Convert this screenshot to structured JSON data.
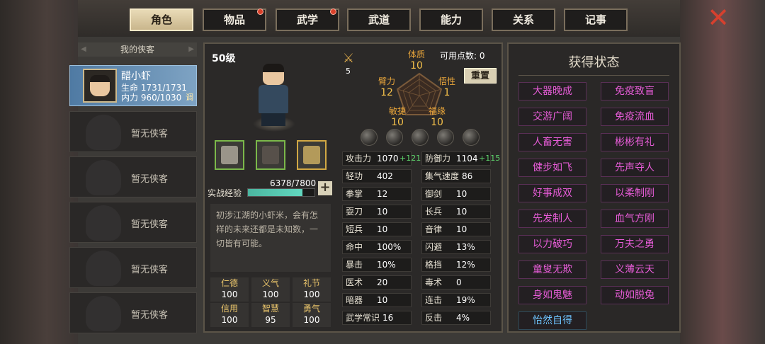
{
  "tabs": [
    {
      "label": "角色",
      "active": true,
      "dot": false
    },
    {
      "label": "物品",
      "active": false,
      "dot": true
    },
    {
      "label": "武学",
      "active": false,
      "dot": true
    },
    {
      "label": "武道",
      "active": false,
      "dot": false
    },
    {
      "label": "能力",
      "active": false,
      "dot": false
    },
    {
      "label": "关系",
      "active": false,
      "dot": false
    },
    {
      "label": "记事",
      "active": false,
      "dot": false
    }
  ],
  "close_icon": "close-icon",
  "list": {
    "header": "我的侠客",
    "hero": {
      "name": "醋小虾",
      "hp": "生命 1731/1731",
      "mp": "内力 960/1030",
      "tune": "调"
    },
    "empty_label": "暂无侠客"
  },
  "center": {
    "level": "50级",
    "exp_label": "实战经验",
    "exp_text": "6378/7800",
    "exp_fraction": 0.818,
    "exp_plus": "+",
    "description": "初涉江湖的小虾米，会有怎样的未来还都是未知数，一切皆有可能。",
    "virtues": [
      {
        "name": "仁德",
        "value": "100"
      },
      {
        "name": "义气",
        "value": "100"
      },
      {
        "name": "礼节",
        "value": "100"
      },
      {
        "name": "信用",
        "value": "100"
      },
      {
        "name": "智慧",
        "value": "95"
      },
      {
        "name": "勇气",
        "value": "100"
      }
    ],
    "attr_icon_num": "5",
    "points_label": "可用点数: 0",
    "reset": "重置",
    "attrs": {
      "tizhi": {
        "name": "体质",
        "value": "10"
      },
      "wuxing": {
        "name": "悟性",
        "value": "1"
      },
      "fuyuan": {
        "name": "福缘",
        "value": "10"
      },
      "minjie": {
        "name": "敏捷",
        "value": "10"
      },
      "bili": {
        "name": "臂力",
        "value": "12"
      }
    },
    "stats": [
      [
        {
          "k": "攻击力",
          "v": "1070",
          "b": "+121"
        },
        {
          "k": "防御力",
          "v": "1104",
          "b": "+115"
        }
      ],
      [
        {
          "k": "轻功",
          "v": "402",
          "b": ""
        },
        {
          "k": "集气速度",
          "v": "86",
          "b": ""
        }
      ],
      [
        {
          "k": "拳掌",
          "v": "12",
          "b": ""
        },
        {
          "k": "御剑",
          "v": "10",
          "b": ""
        }
      ],
      [
        {
          "k": "耍刀",
          "v": "10",
          "b": ""
        },
        {
          "k": "长兵",
          "v": "10",
          "b": ""
        }
      ],
      [
        {
          "k": "短兵",
          "v": "10",
          "b": ""
        },
        {
          "k": "音律",
          "v": "10",
          "b": ""
        }
      ],
      [
        {
          "k": "命中",
          "v": "100%",
          "b": ""
        },
        {
          "k": "闪避",
          "v": "13%",
          "b": ""
        }
      ],
      [
        {
          "k": "暴击",
          "v": "10%",
          "b": ""
        },
        {
          "k": "格挡",
          "v": "12%",
          "b": ""
        }
      ],
      [
        {
          "k": "医术",
          "v": "20",
          "b": ""
        },
        {
          "k": "毒术",
          "v": "0",
          "b": ""
        }
      ],
      [
        {
          "k": "暗器",
          "v": "10",
          "b": ""
        },
        {
          "k": "连击",
          "v": "19%",
          "b": ""
        }
      ],
      [
        {
          "k": "武学常识",
          "v": "16",
          "b": ""
        },
        {
          "k": "反击",
          "v": "4%",
          "b": ""
        }
      ]
    ]
  },
  "right": {
    "title": "获得状态",
    "statuses": [
      "大器晚成",
      "免疫致盲",
      "交游广阔",
      "免疫流血",
      "人畜无害",
      "彬彬有礼",
      "健步如飞",
      "先声夺人",
      "好事成双",
      "以柔制刚",
      "先发制人",
      "血气方刚",
      "以力破巧",
      "万夫之勇",
      "童叟无欺",
      "义薄云天",
      "身如鬼魅",
      "动如脱兔",
      "怡然自得"
    ]
  }
}
